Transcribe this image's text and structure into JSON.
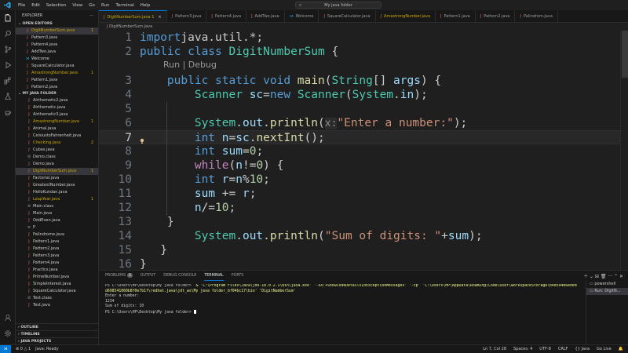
{
  "menu": [
    "File",
    "Edit",
    "Selection",
    "View",
    "Go",
    "Run",
    "Terminal",
    "Help"
  ],
  "search_text": "My java folder",
  "sidebar": {
    "title": "EXPLORER",
    "open_editors_label": "OPEN EDITORS",
    "open_editors": [
      {
        "name": "DigitNumberSum.java",
        "badge": "1",
        "warn": true,
        "selected": true
      },
      {
        "name": "Pattern3.java",
        "badge": "",
        "warn": false
      },
      {
        "name": "Pattern4.java",
        "badge": "",
        "warn": false
      },
      {
        "name": "AddTwo.java",
        "badge": "",
        "warn": false
      },
      {
        "name": "Welcome",
        "badge": "",
        "warn": false
      },
      {
        "name": "SquareCalculator.java",
        "badge": "",
        "warn": false
      },
      {
        "name": "AmastrongNumber.java",
        "badge": "1",
        "warn": true
      },
      {
        "name": "Pattern1.java",
        "badge": "",
        "warn": false
      },
      {
        "name": "Pattern2.java",
        "badge": "",
        "warn": false
      }
    ],
    "folder_label": "MY JAVA FOLDER",
    "files": [
      {
        "name": "Airthemetic2.java",
        "badge": "",
        "warn": false
      },
      {
        "name": "Airthemetic.java",
        "badge": "",
        "warn": false
      },
      {
        "name": "Airthemetic3.java",
        "badge": "",
        "warn": false
      },
      {
        "name": "AmastrongNumber.java",
        "badge": "1",
        "warn": true
      },
      {
        "name": "Animal.java",
        "badge": "",
        "warn": false
      },
      {
        "name": "CelsiustoFahrenheit.java",
        "badge": "",
        "warn": false
      },
      {
        "name": "Checking.java",
        "badge": "2",
        "warn": true
      },
      {
        "name": "Cubes.java",
        "badge": "",
        "warn": false
      },
      {
        "name": "Demo.class",
        "badge": "",
        "warn": false
      },
      {
        "name": "Demo.java",
        "badge": "",
        "warn": false
      },
      {
        "name": "DigitNumberSum.java",
        "badge": "1",
        "warn": true,
        "selected": true
      },
      {
        "name": "Factorial.java",
        "badge": "",
        "warn": false
      },
      {
        "name": "GreatestNumber.java",
        "badge": "",
        "warn": false
      },
      {
        "name": "HelloKundan.java",
        "badge": "",
        "warn": false
      },
      {
        "name": "LeapYear.java",
        "badge": "1",
        "warn": true
      },
      {
        "name": "Main.class",
        "badge": "",
        "warn": false
      },
      {
        "name": "Main.java",
        "badge": "",
        "warn": false
      },
      {
        "name": "OddEven.java",
        "badge": "",
        "warn": false
      },
      {
        "name": "P",
        "badge": "",
        "warn": false
      },
      {
        "name": "Palindrome.java",
        "badge": "",
        "warn": false
      },
      {
        "name": "Pattern1.java",
        "badge": "",
        "warn": false
      },
      {
        "name": "Pattern2.java",
        "badge": "",
        "warn": false
      },
      {
        "name": "Pattern3.java",
        "badge": "",
        "warn": false
      },
      {
        "name": "Pattern4.java",
        "badge": "",
        "warn": false
      },
      {
        "name": "Practics.java",
        "badge": "",
        "warn": false
      },
      {
        "name": "PrimeNumber.java",
        "badge": "",
        "warn": false
      },
      {
        "name": "SimpleInterest.java",
        "badge": "",
        "warn": false
      },
      {
        "name": "SquareCalculator.java",
        "badge": "",
        "warn": false
      },
      {
        "name": "Test.class",
        "badge": "",
        "warn": false
      },
      {
        "name": "Test.java",
        "badge": "",
        "warn": false
      }
    ],
    "bottom_sections": [
      "OUTLINE",
      "TIMELINE",
      "JAVA PROJECTS"
    ]
  },
  "tabs": [
    {
      "label": "DigitNumberSum.java 1",
      "active": true,
      "warn": true
    },
    {
      "label": "Pattern3.java",
      "active": false,
      "warn": false
    },
    {
      "label": "Pattern4.java",
      "active": false,
      "warn": false
    },
    {
      "label": "AddTwo.java",
      "active": false,
      "warn": false
    },
    {
      "label": "Welcome",
      "active": false,
      "warn": false
    },
    {
      "label": "SquareCalculator.java",
      "active": false,
      "warn": false
    },
    {
      "label": "AmastrongNumber.java",
      "active": false,
      "warn": true
    },
    {
      "label": "Pattern1.java",
      "active": false,
      "warn": false
    },
    {
      "label": "Pattern2.java",
      "active": false,
      "warn": false
    },
    {
      "label": "Palindrom.java",
      "active": false,
      "warn": false
    }
  ],
  "breadcrumb": "DigitNumberSum.java",
  "codelens": "Run | Debug",
  "code_lines": [
    {
      "num": "1",
      "tokens": [
        [
          "kw",
          "import"
        ],
        [
          "",
          "java.util.*;"
        ]
      ]
    },
    {
      "num": "2",
      "tokens": [
        [
          "kw",
          "public class "
        ],
        [
          "ty",
          "DigitNumberSum"
        ],
        [
          "",
          " {"
        ]
      ]
    },
    {
      "num": "3",
      "tokens": [
        [
          "",
          "    "
        ],
        [
          "kw",
          "public static void "
        ],
        [
          "fn",
          "main"
        ],
        [
          "",
          "("
        ],
        [
          "ty",
          "String"
        ],
        [
          "",
          "[] "
        ],
        [
          "var",
          "args"
        ],
        [
          "",
          ") {"
        ]
      ]
    },
    {
      "num": "4",
      "tokens": [
        [
          "",
          "        "
        ],
        [
          "ty",
          "Scanner "
        ],
        [
          "var",
          "sc"
        ],
        [
          "",
          "="
        ],
        [
          "kw",
          "new "
        ],
        [
          "ty",
          "Scanner"
        ],
        [
          "",
          "("
        ],
        [
          "ty",
          "System"
        ],
        [
          "",
          "."
        ],
        [
          "var",
          "in"
        ],
        [
          "",
          ");"
        ]
      ]
    },
    {
      "num": "5",
      "tokens": []
    },
    {
      "num": "6",
      "tokens": [
        [
          "",
          "        "
        ],
        [
          "ty",
          "System"
        ],
        [
          "",
          "."
        ],
        [
          "var",
          "out"
        ],
        [
          "",
          "."
        ],
        [
          "fn",
          "println"
        ],
        [
          "",
          "("
        ],
        [
          "hint",
          "x:"
        ],
        [
          "str",
          "\"Enter a number:\""
        ],
        [
          "",
          ");"
        ]
      ]
    },
    {
      "num": "7",
      "tokens": [
        [
          "",
          "        "
        ],
        [
          "kw",
          "int "
        ],
        [
          "var",
          "n"
        ],
        [
          "",
          "="
        ],
        [
          "var",
          "sc"
        ],
        [
          "",
          "."
        ],
        [
          "fn",
          "nextInt"
        ],
        [
          "",
          "();"
        ]
      ]
    },
    {
      "num": "8",
      "tokens": [
        [
          "",
          "        "
        ],
        [
          "kw",
          "int "
        ],
        [
          "var",
          "sum"
        ],
        [
          "",
          "="
        ],
        [
          "num",
          "0"
        ],
        [
          "",
          ";"
        ]
      ]
    },
    {
      "num": "9",
      "tokens": [
        [
          "",
          "        "
        ],
        [
          "ctl",
          "while"
        ],
        [
          "",
          "("
        ],
        [
          "var",
          "n"
        ],
        [
          "",
          "!="
        ],
        [
          "num",
          "0"
        ],
        [
          "",
          ") {"
        ]
      ]
    },
    {
      "num": "10",
      "tokens": [
        [
          "",
          "        "
        ],
        [
          "kw",
          "int "
        ],
        [
          "var",
          "r"
        ],
        [
          "",
          "="
        ],
        [
          "var",
          "n"
        ],
        [
          "",
          "%"
        ],
        [
          "num",
          "10"
        ],
        [
          "",
          ";"
        ]
      ]
    },
    {
      "num": "11",
      "tokens": [
        [
          "",
          "        "
        ],
        [
          "var",
          "sum"
        ],
        [
          "",
          " += "
        ],
        [
          "var",
          "r"
        ],
        [
          "",
          ";"
        ]
      ]
    },
    {
      "num": "12",
      "tokens": [
        [
          "",
          "        "
        ],
        [
          "var",
          "n"
        ],
        [
          "",
          "/="
        ],
        [
          "num",
          "10"
        ],
        [
          "",
          ";"
        ]
      ]
    },
    {
      "num": "13",
      "tokens": [
        [
          "",
          "    }"
        ]
      ]
    },
    {
      "num": "14",
      "tokens": [
        [
          "",
          "        "
        ],
        [
          "ty",
          "System"
        ],
        [
          "",
          "."
        ],
        [
          "var",
          "out"
        ],
        [
          "",
          "."
        ],
        [
          "fn",
          "println"
        ],
        [
          "",
          "("
        ],
        [
          "str",
          "\"Sum of digits: \""
        ],
        [
          "",
          "+"
        ],
        [
          "var",
          "sum"
        ],
        [
          "",
          ");"
        ]
      ]
    },
    {
      "num": "15",
      "tokens": [
        [
          "",
          "   }"
        ]
      ]
    },
    {
      "num": "16",
      "tokens": [
        [
          "",
          "}"
        ]
      ]
    }
  ],
  "panel": {
    "tabs": [
      "PROBLEMS",
      "OUTPUT",
      "DEBUG CONSOLE",
      "TERMINAL",
      "PORTS"
    ],
    "problems_badge": "5",
    "active_tab": "TERMINAL",
    "terminal_lines": [
      "PS C:\\Users\\HP\\Desktop\\My java folder>  & 'C:\\Program Files\\Java\\jdk-18.0.2.1\\bin\\java.exe' '-XX:+ShowCodeDetailsInExceptionMessages' '-cp' 'C:\\Users\\HP\\AppData\\Roaming\\Code\\User\\workspaceStorage\\b48594b6e0ed",
      "d698541060b8f0e7b1f\\redhat.java\\jdt_ws\\My java folder_bf04bc17\\bin' 'DigitNumberSum'",
      "Enter a number:",
      "1234",
      "Sum of digits: 10",
      "PS C:\\Users\\HP\\Desktop\\My java folder> "
    ],
    "terminal_list": [
      "powershell",
      "Run: DigitN..."
    ]
  },
  "statusbar": {
    "left": [
      "⊗ 0 △ 1",
      "Java: Ready"
    ],
    "right": [
      "Ln 7, Col 28",
      "Spaces: 4",
      "UTF-8",
      "CRLF",
      "{} Java",
      "Go Live"
    ]
  }
}
